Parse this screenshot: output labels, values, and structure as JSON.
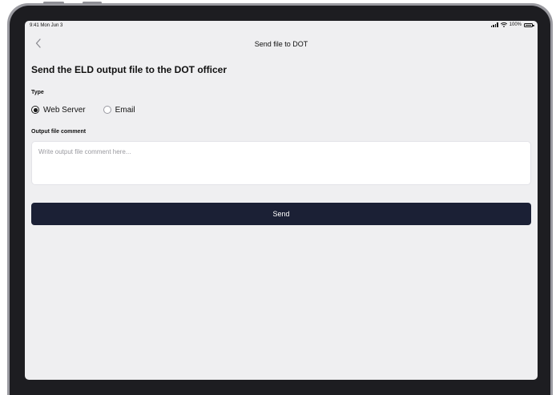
{
  "status_bar": {
    "time": "9:41 Mon Jun 3",
    "battery": "100%"
  },
  "nav": {
    "back_icon": "chevron-left-icon",
    "title": "Send file to DOT"
  },
  "page": {
    "heading": "Send the ELD output file to the DOT officer"
  },
  "type_section": {
    "label": "Type",
    "options": [
      {
        "label": "Web Server",
        "selected": true
      },
      {
        "label": "Email",
        "selected": false
      }
    ]
  },
  "comment_section": {
    "label": "Output file comment",
    "value": "",
    "placeholder": "Write output file comment here..."
  },
  "send_button": {
    "label": "Send"
  },
  "colors": {
    "screen_background": "#efeff1",
    "primary_button": "#1b2035",
    "text": "#111111",
    "placeholder": "#9a9aa0"
  }
}
